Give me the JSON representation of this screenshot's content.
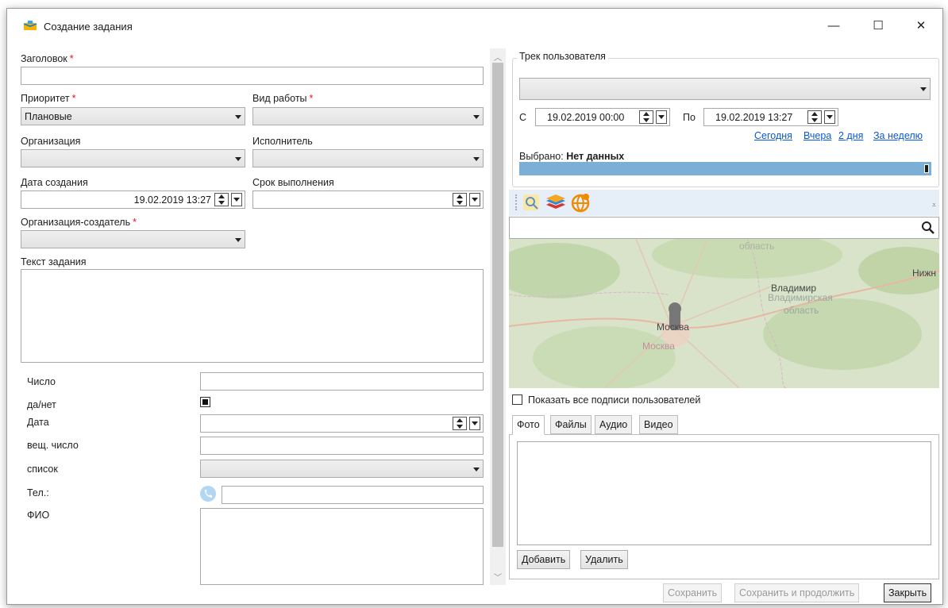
{
  "window": {
    "title": "Создание задания",
    "minimize": "—",
    "maximize": "☐",
    "close": "✕"
  },
  "form": {
    "title_label": "Заголовок",
    "priority_label": "Приоритет",
    "priority_value": "Плановые",
    "work_type_label": "Вид работы",
    "organization_label": "Организация",
    "executor_label": "Исполнитель",
    "created_label": "Дата создания",
    "created_value": "19.02.2019 13:27",
    "deadline_label": "Срок выполнения",
    "creator_org_label": "Организация-создатель",
    "task_text_label": "Текст задания",
    "required_mark": "*"
  },
  "extra_fields": {
    "number_label": "Число",
    "yesno_label": "да/нет",
    "date_label": "Дата",
    "real_label": "вещ. число",
    "list_label": "список",
    "phone_label": "Тел.:",
    "fio_label": "ФИО"
  },
  "track": {
    "group_label": "Трек пользователя",
    "from_label": "С",
    "from_value": "19.02.2019 00:00",
    "to_label": "По",
    "to_value": "19.02.2019 13:27",
    "links": [
      "Сегодня",
      "Вчера",
      "2 дня",
      "За неделю"
    ],
    "selected_label": "Выбрано:",
    "selected_value": "Нет данных"
  },
  "map": {
    "labels": [
      "область",
      "Нижн",
      "Владимир",
      "Владимирская",
      "область",
      "Москва",
      "Москва"
    ],
    "show_all_label": "Показать все подписи пользователей"
  },
  "media": {
    "tabs": [
      "Фото",
      "Файлы",
      "Аудио",
      "Видео"
    ],
    "active_tab": "Фото",
    "add_label": "Добавить",
    "delete_label": "Удалить"
  },
  "footer": {
    "save_label": "Сохранить",
    "save_continue_label": "Сохранить и продолжить",
    "close_label": "Закрыть"
  },
  "colors": {
    "accent_link": "#0a5ad5",
    "required": "#e0141e",
    "progress": "#7bafd6"
  }
}
